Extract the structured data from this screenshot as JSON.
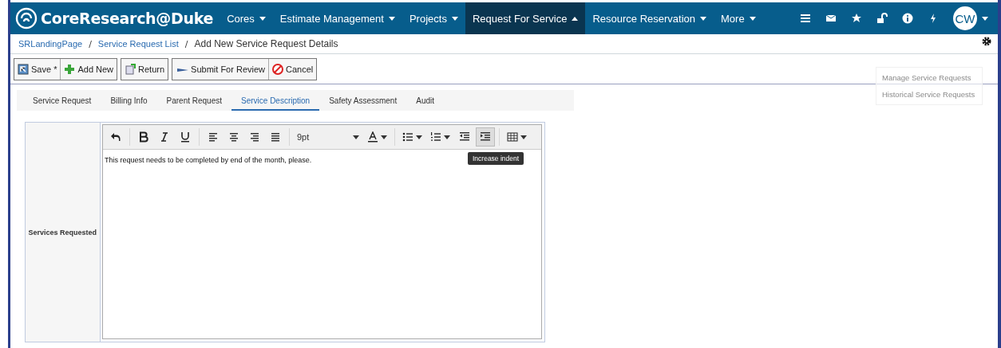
{
  "header": {
    "logo": "CoreResearch@Duke",
    "nav": [
      {
        "label": "Cores",
        "selected": false
      },
      {
        "label": "Estimate Management",
        "selected": false
      },
      {
        "label": "Projects",
        "selected": false
      },
      {
        "label": "Request For Service",
        "selected": true
      },
      {
        "label": "Resource Reservation",
        "selected": false
      },
      {
        "label": "More",
        "selected": false
      }
    ],
    "avatar": "CW"
  },
  "breadcrumb": {
    "separator": "/",
    "links": [
      "SRLandingPage",
      "Service Request List"
    ],
    "current": "Add New Service Request Details"
  },
  "actions": [
    {
      "label": "Save *",
      "kind": "save"
    },
    {
      "label": "Add New",
      "kind": "add"
    },
    {
      "label": "Return",
      "kind": "return"
    },
    {
      "label": "Submit For Review",
      "kind": "submit"
    },
    {
      "label": "Cancel",
      "kind": "cancel"
    }
  ],
  "side_menu": [
    "Manage Service Requests",
    "Historical Service Requests"
  ],
  "tabs": [
    {
      "label": "Service Request",
      "selected": false
    },
    {
      "label": "Billing Info",
      "selected": false
    },
    {
      "label": "Parent Request",
      "selected": false
    },
    {
      "label": "Service Description",
      "selected": true
    },
    {
      "label": "Safety Assessment",
      "selected": false
    },
    {
      "label": "Audit",
      "selected": false
    }
  ],
  "form": {
    "label": "Services Requested",
    "editor": {
      "font_size": "9pt",
      "tooltip": "Increase indent",
      "text": "This request needs to be completed by end of the month, please."
    }
  }
}
